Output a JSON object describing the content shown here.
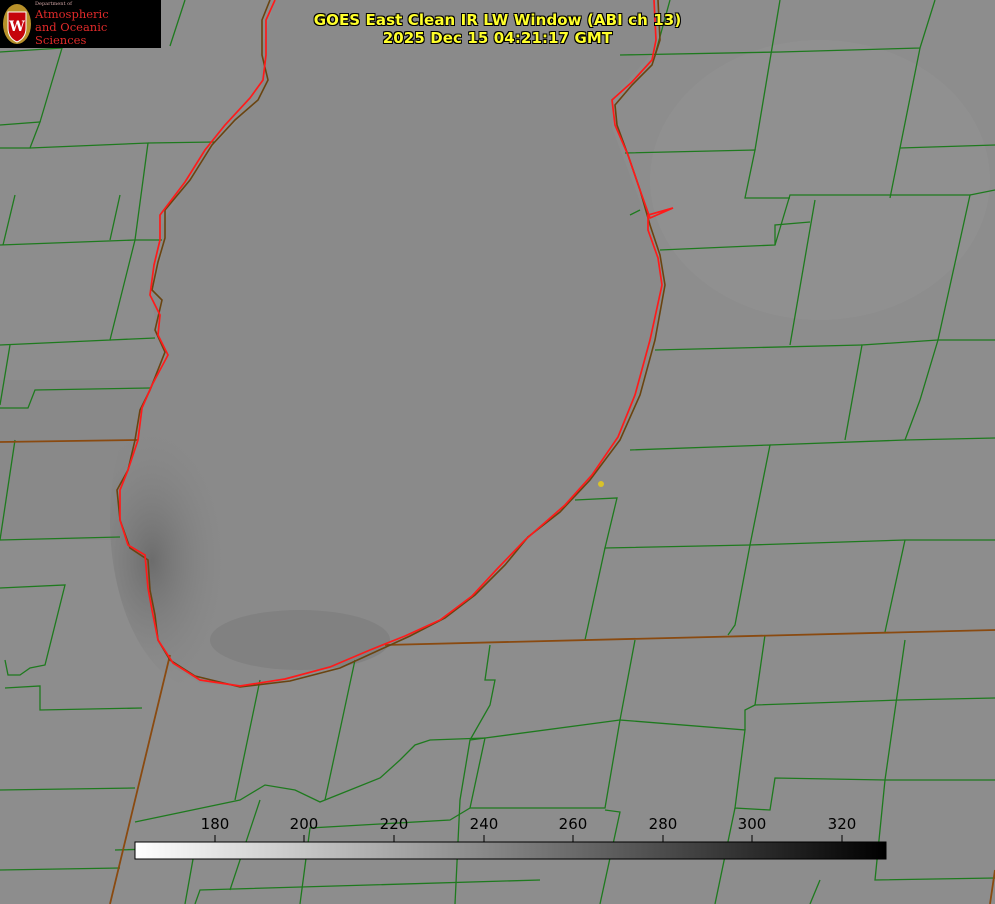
{
  "logo": {
    "department": "Department of",
    "line1": "Atmospheric",
    "line2": "and Oceanic Sciences",
    "seal_letter": "W"
  },
  "title": {
    "line1": "GOES East Clean IR LW Window (ABI ch 13)",
    "line2": "2025 Dec 15 04:21:17 GMT"
  },
  "colorbar": {
    "ticks": [
      "180",
      "200",
      "220",
      "240",
      "260",
      "280",
      "300",
      "320"
    ],
    "colormap": "greyscale white-to-black"
  },
  "colors": {
    "title_text": "#ffff2b",
    "county_lines": "#1e7a1e",
    "state_lines": "#8a4a10",
    "lake_outline": "#ff1a1a",
    "marker_dot": "#d8c22a"
  }
}
